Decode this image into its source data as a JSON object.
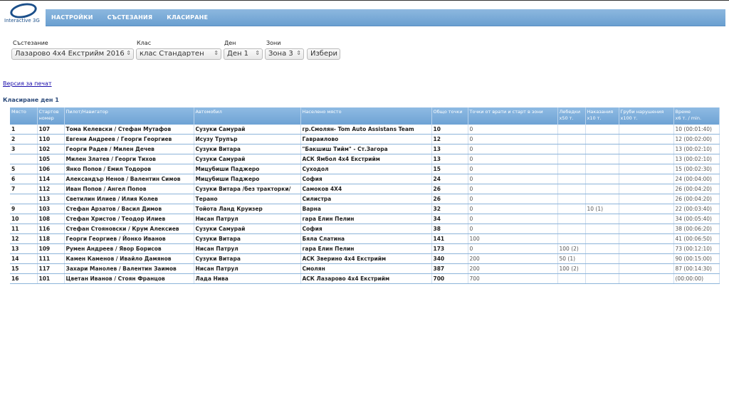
{
  "logo": {
    "text": "Interactive 3G"
  },
  "nav": [
    "НАСТРОЙКИ",
    "СЪСТЕЗАНИЯ",
    "КЛАСИРАНЕ"
  ],
  "filters": {
    "competition": {
      "label": "Състезание",
      "value": "Лазарово 4x4 Екстрийм 2016"
    },
    "class": {
      "label": "Клас",
      "value": "клас Стандартен"
    },
    "day": {
      "label": "Ден",
      "value": "Ден 1"
    },
    "zones": {
      "label": "Зони",
      "value": "Зона 3"
    },
    "submit": "Избери"
  },
  "print_link": "Версия за печат",
  "section_title": "Класиране ден 1",
  "table": {
    "headers": [
      [
        "Място",
        ""
      ],
      [
        "Стартов",
        "номер"
      ],
      [
        "Пилот/Навигатор",
        ""
      ],
      [
        "Автомобил",
        ""
      ],
      [
        "Населено място",
        ""
      ],
      [
        "Общо точки",
        ""
      ],
      [
        "Точки от врати и старт в зони",
        ""
      ],
      [
        "Лебедки",
        "x50 т."
      ],
      [
        "Наказания",
        "x10 т."
      ],
      [
        "Груби нарушения",
        "x100 т."
      ],
      [
        "Време",
        "x6 т. / min."
      ]
    ],
    "rows": [
      [
        "1",
        "107",
        "Тома Келевски / Стефан Мутафов",
        "Сузуки Самурай",
        "гр.Смолян- Tom Auto Assistans Team",
        "10",
        "0",
        "",
        "",
        "",
        "10 (00:01:40)"
      ],
      [
        "2",
        "110",
        "Евгени Андреев / Георги Георгиев",
        "Исузу Трупър",
        "Гавраилово",
        "12",
        "0",
        "",
        "",
        "",
        "12 (00:02:00)"
      ],
      [
        "3",
        "102",
        "Георги Радев / Милен Дечев",
        "Сузуки Витара",
        "\"Бакшиш Тийм\" - Ст.Загора",
        "13",
        "0",
        "",
        "",
        "",
        "13 (00:02:10)"
      ],
      [
        "",
        "105",
        "Милен Златев / Георги Тихов",
        "Сузуки Самурай",
        "АСК Ямбол 4x4 Екстрийм",
        "13",
        "0",
        "",
        "",
        "",
        "13 (00:02:10)"
      ],
      [
        "5",
        "106",
        "Янко Попов / Емил Тодоров",
        "Мицубиши Паджеро",
        "Суходол",
        "15",
        "0",
        "",
        "",
        "",
        "15 (00:02:30)"
      ],
      [
        "6",
        "114",
        "Александър Ненов / Валентин Симов",
        "Мицубиши Паджеро",
        "София",
        "24",
        "0",
        "",
        "",
        "",
        "24 (00:04:00)"
      ],
      [
        "7",
        "112",
        "Иван Попов / Ангел Попов",
        "Сузуки Витара /без тракторки/",
        "Самоков 4Х4",
        "26",
        "0",
        "",
        "",
        "",
        "26 (00:04:20)"
      ],
      [
        "",
        "113",
        "Светилин Илиев / Илия Колев",
        "Терано",
        "Силистра",
        "26",
        "0",
        "",
        "",
        "",
        "26 (00:04:20)"
      ],
      [
        "9",
        "103",
        "Стефан Арзатов / Васил Димов",
        "Тойота Ланд Круизер",
        "Варна",
        "32",
        "0",
        "",
        "10 (1)",
        "",
        "22 (00:03:40)"
      ],
      [
        "10",
        "108",
        "Стефан Христов / Теодор Илиев",
        "Нисан Патрул",
        "гара Елин Пелин",
        "34",
        "0",
        "",
        "",
        "",
        "34 (00:05:40)"
      ],
      [
        "11",
        "116",
        "Стефан Стояновски / Крум Алексиев",
        "Сузуки Самурай",
        "София",
        "38",
        "0",
        "",
        "",
        "",
        "38 (00:06:20)"
      ],
      [
        "12",
        "118",
        "Георги Георгиев / Йонко Иванов",
        "Сузуки Витара",
        "Бяла Слатина",
        "141",
        "100",
        "",
        "",
        "",
        "41 (00:06:50)"
      ],
      [
        "13",
        "109",
        "Румен Андреев / Явор Борисов",
        "Нисан Патрул",
        "гара Елин Пелин",
        "173",
        "0",
        "100 (2)",
        "",
        "",
        "73 (00:12:10)"
      ],
      [
        "14",
        "111",
        "Камен Каменов / Ивайло Дамянов",
        "Сузуки Витара",
        "АСК Зверино 4x4 Екстрийм",
        "340",
        "200",
        "50 (1)",
        "",
        "",
        "90 (00:15:00)"
      ],
      [
        "15",
        "117",
        "Захари Манолев / Валентин Заимов",
        "Нисан Патрул",
        "Смолян",
        "387",
        "200",
        "100 (2)",
        "",
        "",
        "87 (00:14:30)"
      ],
      [
        "16",
        "101",
        "Цветан Иванов / Стоян Францов",
        "Лада Нива",
        "АСК Лазарово 4x4 Екстрийм",
        "700",
        "700",
        "",
        "",
        "",
        "(00:00:00)"
      ]
    ]
  }
}
